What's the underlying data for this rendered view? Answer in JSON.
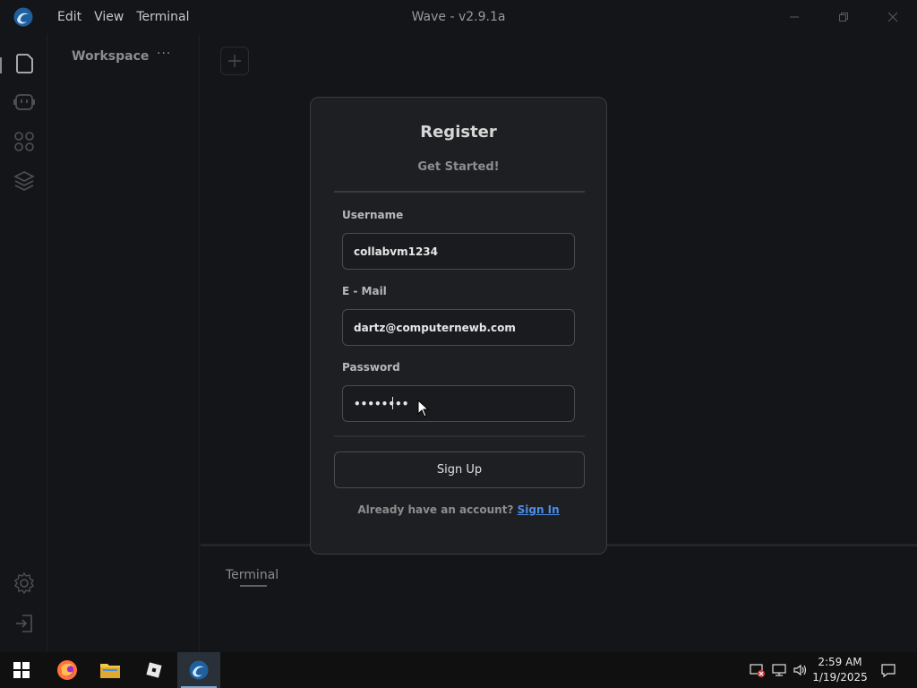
{
  "window": {
    "title": "Wave - v2.9.1a"
  },
  "menu": {
    "edit": "Edit",
    "view": "View",
    "terminal": "Terminal"
  },
  "workspace": {
    "title": "Workspace",
    "more": "···"
  },
  "terminal": {
    "tab_label": "Terminal"
  },
  "register": {
    "title": "Register",
    "subtitle": "Get Started!",
    "username_label": "Username",
    "username_value": "collabvm1234",
    "email_label": "E - Mail",
    "email_value": "dartz@computernewb.com",
    "password_label": "Password",
    "password_value": "••••••••",
    "signup_label": "Sign Up",
    "signin_prompt": "Already have an account?",
    "signin_link": "Sign In"
  },
  "taskbar": {
    "time": "2:59 AM",
    "date": "1/19/2025"
  },
  "icons": [
    "wave-logo-icon",
    "file-icon",
    "robot-icon",
    "apps-grid-icon",
    "layers-icon",
    "settings-icon",
    "logout-icon",
    "windows-start-icon",
    "firefox-icon",
    "folder-icon",
    "roblox-icon",
    "wave-icon",
    "network-warning-icon",
    "network-icon",
    "volume-icon",
    "notification-icon"
  ],
  "colors": {
    "accent": "#4c8ee8",
    "background": "#141518",
    "modal": "#1e1f22"
  }
}
